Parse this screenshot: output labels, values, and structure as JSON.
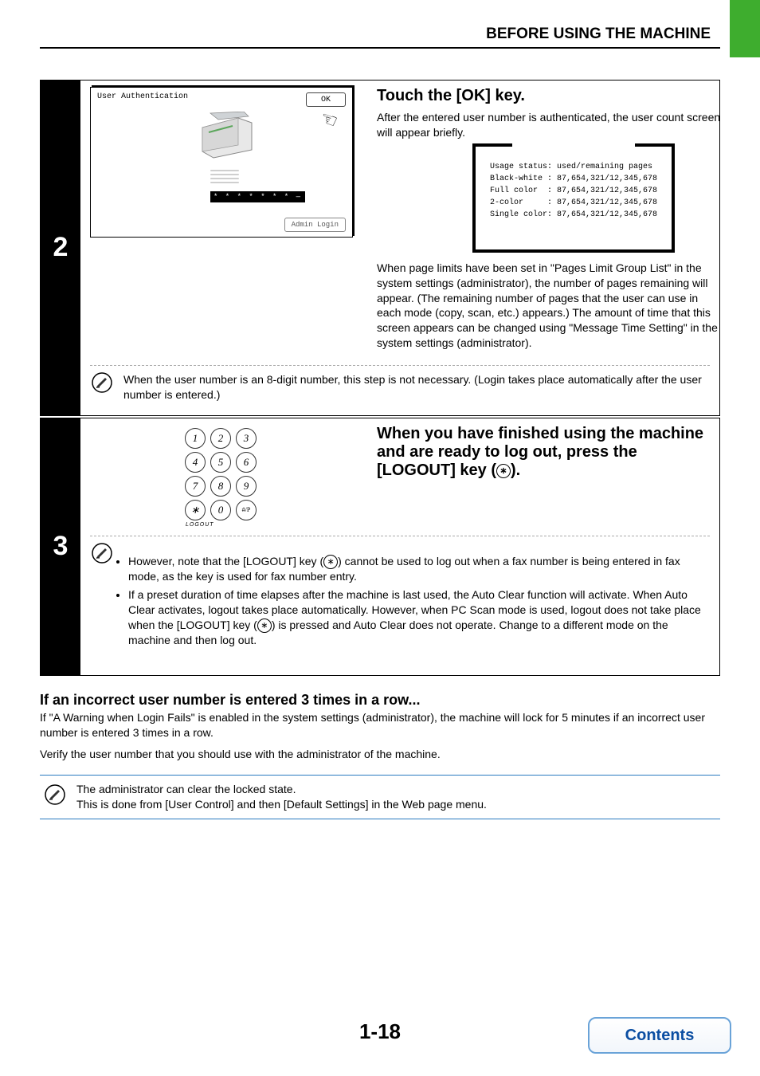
{
  "header": {
    "title": "BEFORE USING THE MACHINE"
  },
  "step2": {
    "num": "2",
    "panel_title": "User Authentication",
    "ok_label": "OK",
    "stars": "* * * * * * * —",
    "admin_label": "Admin Login",
    "heading": "Touch the [OK] key.",
    "intro": "After the entered user number is authenticated, the user count screen will appear briefly.",
    "usage_lines": "Usage status: used/remaining pages\nBlack-white : 87,654,321/12,345,678\nFull color  : 87,654,321/12,345,678\n2-color     : 87,654,321/12,345,678\nSingle color: 87,654,321/12,345,678",
    "after_usage": "When page limits have been set in \"Pages Limit Group List\" in the system settings (administrator), the number of pages remaining will appear. (The remaining number of pages that the user can use in each mode (copy, scan, etc.) appears.) The amount of time that this screen appears can be changed using \"Message Time Setting\" in the system settings (administrator).",
    "note": "When the user number is an 8-digit number, this step is not necessary. (Login takes place automatically after the user number is entered.)"
  },
  "step3": {
    "num": "3",
    "keys": [
      "1",
      "2",
      "3",
      "4",
      "5",
      "6",
      "7",
      "8",
      "9",
      "",
      "0",
      "#/P"
    ],
    "star": "∗",
    "keypad_caption": "LOGOUT",
    "heading_a": "When you have finished using the machine and are ready to log out, press the [LOGOUT] key (",
    "heading_b": ").",
    "bullet1_a": "However, note that the [LOGOUT] key (",
    "bullet1_b": ") cannot be used to log out when a fax number is being entered in fax mode, as the key is used for fax number entry.",
    "bullet2_a": "If a preset duration of time elapses after the machine is last used, the Auto Clear function will activate. When Auto Clear activates, logout takes place automatically. However, when PC Scan mode is used, logout does not take place when the [LOGOUT] key (",
    "bullet2_b": ") is pressed and Auto Clear does not operate. Change to a different mode on the machine and then log out."
  },
  "lower": {
    "sub_heading": "If an incorrect user number is entered 3 times in a row...",
    "p1": "If \"A Warning when Login Fails\" is enabled in the system settings (administrator), the machine will lock for 5 minutes if an incorrect user number is entered 3 times in a row.",
    "p2": "Verify the user number that you should use with the administrator of the machine.",
    "note_l1": "The administrator can clear the locked state.",
    "note_l2": "This is done from [User Control] and then [Default Settings] in the Web page menu."
  },
  "page_number": "1-18",
  "contents_label": "Contents"
}
